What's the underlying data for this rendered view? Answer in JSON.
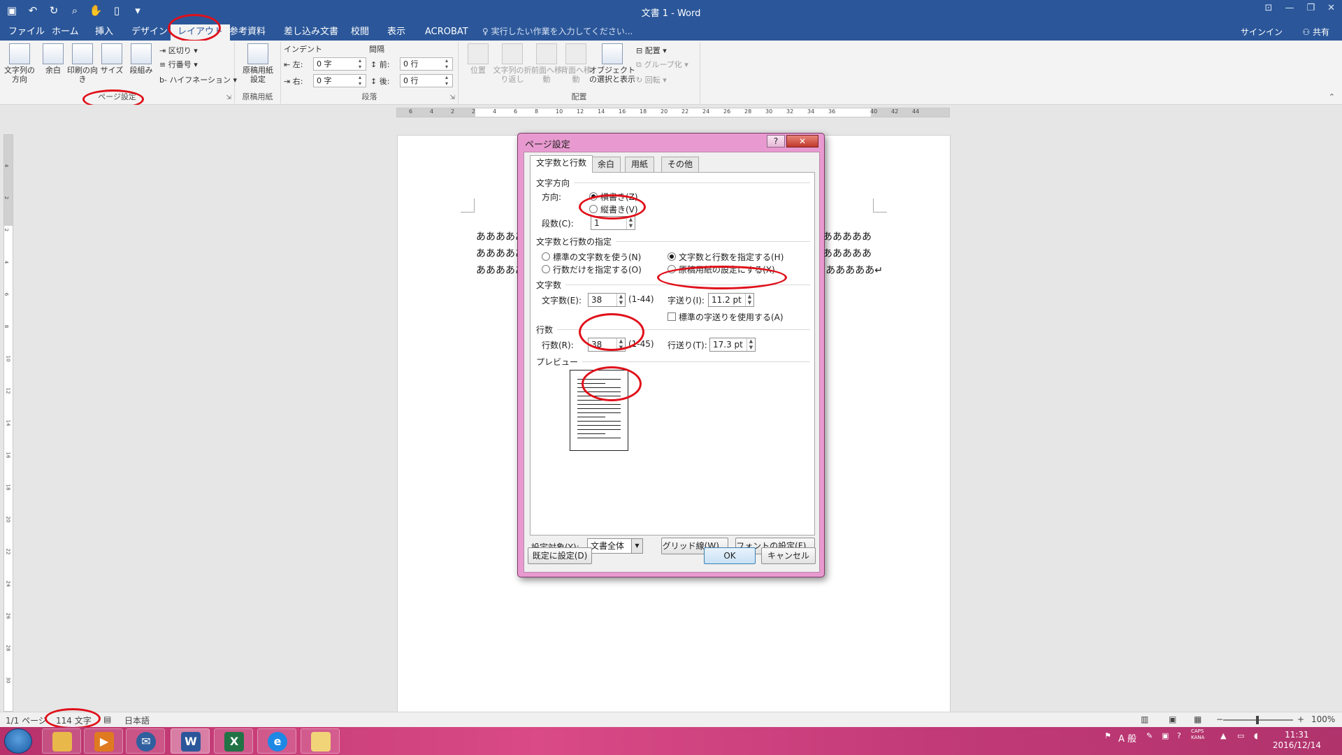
{
  "window": {
    "title": "文書 1 - Word"
  },
  "qat": {
    "save_icon": "save-icon",
    "undo_icon": "undo-icon",
    "redo_icon": "redo-icon"
  },
  "tabs": [
    {
      "label": "ファイル"
    },
    {
      "label": "ホーム"
    },
    {
      "label": "挿入"
    },
    {
      "label": "デザイン"
    },
    {
      "label": "レイアウト"
    },
    {
      "label": "参考資料"
    },
    {
      "label": "差し込み文書"
    },
    {
      "label": "校閲"
    },
    {
      "label": "表示"
    },
    {
      "label": "ACROBAT"
    }
  ],
  "tellme": "実行したい作業を入力してください...",
  "account": {
    "signin": "サインイン",
    "share": "共有"
  },
  "ribbon": {
    "page_setup": {
      "label": "ページ設定",
      "text_direction": "文字列の方向",
      "margins": "余白",
      "orientation": "印刷の向き",
      "size": "サイズ",
      "columns": "段組み",
      "breaks": "区切り",
      "line_numbers": "行番号",
      "hyphenation": "ハイフネーション"
    },
    "manuscript": {
      "label": "原稿用紙",
      "button": "原稿用紙設定"
    },
    "paragraph": {
      "label": "段落",
      "indent": "インデント",
      "spacing": "間隔",
      "left": "左:",
      "right": "右:",
      "before": "前:",
      "after": "後:",
      "left_val": "0 字",
      "right_val": "0 字",
      "before_val": "0 行",
      "after_val": "0 行"
    },
    "arrange": {
      "label": "配置",
      "position": "位置",
      "wrap": "文字列の折り返し",
      "forward": "前面へ移動",
      "backward": "背面へ移動",
      "selection": "オブジェクトの選択と表示",
      "align": "配置",
      "group": "グループ化",
      "rotate": "回転"
    }
  },
  "ruler": {
    "h": [
      "6",
      "4",
      "2",
      "2",
      "4",
      "6",
      "8",
      "10",
      "12",
      "14",
      "16",
      "18",
      "20",
      "22",
      "24",
      "26",
      "28",
      "30",
      "32",
      "34",
      "36",
      "40",
      "42",
      "44"
    ],
    "v": [
      "4",
      "2",
      "2",
      "4",
      "6",
      "8",
      "10",
      "12",
      "14",
      "16",
      "18",
      "20",
      "22",
      "24",
      "26",
      "28",
      "30"
    ]
  },
  "document": {
    "line_left": "あああああ",
    "line_right_1": "あああああ",
    "line_right_2": "あああああ",
    "line_right_3": "あああああ↵"
  },
  "dialog": {
    "title": "ページ設定",
    "help": "?",
    "close": "✕",
    "tabs": [
      "文字数と行数",
      "余白",
      "用紙",
      "その他"
    ],
    "direction_section": "文字方向",
    "direction_label": "方向:",
    "horizontal": "横書き(Z)",
    "vertical": "縦書き(V)",
    "columns_label": "段数(C):",
    "columns_value": "1",
    "grid_section": "文字数と行数の指定",
    "grid_options": [
      "標準の文字数を使う(N)",
      "文字数と行数を指定する(H)",
      "行数だけを指定する(O)",
      "原稿用紙の設定にする(X)"
    ],
    "chars_section": "文字数",
    "chars_label": "文字数(E):",
    "chars_value": "38",
    "chars_range": "(1-44)",
    "pitch_label": "字送り(I):",
    "pitch_value": "11.2 pt",
    "use_default_pitch": "標準の字送りを使用する(A)",
    "lines_section": "行数",
    "lines_label": "行数(R):",
    "lines_value": "38",
    "lines_range": "(1-45)",
    "line_pitch_label": "行送り(T):",
    "line_pitch_value": "17.3 pt",
    "preview_section": "プレビュー",
    "apply_label": "設定対象(Y):",
    "apply_value": "文書全体",
    "grid_button": "グリッド線(W)...",
    "font_button": "フォントの設定(F)...",
    "default_button": "既定に設定(D)",
    "ok": "OK",
    "cancel": "キャンセル"
  },
  "status": {
    "page": "1/1 ページ",
    "words": "114 文字",
    "language": "日本語",
    "zoom": "100%"
  },
  "taskbar": {
    "tray_caps": "CAPS",
    "tray_kana": "KANA",
    "ime": "A 般",
    "time": "11:31",
    "date": "2016/12/14"
  },
  "colors": {
    "word_blue": "#2b579a",
    "annotation_red": "#e0101a",
    "dialog_frame": "#e89ad0"
  }
}
